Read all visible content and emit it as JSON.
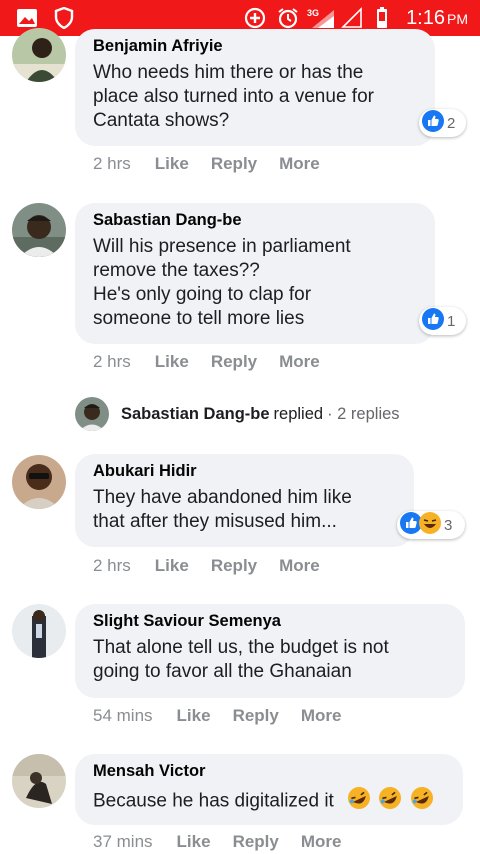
{
  "status_bar": {
    "time": "1:16",
    "ampm": "PM",
    "network": "3G",
    "icons": [
      "gallery-icon",
      "shield-icon",
      "add-circle-icon",
      "alarm-icon",
      "signal-3g-icon",
      "signal-empty-icon",
      "battery-icon"
    ]
  },
  "colors": {
    "status_bar": "#f01818",
    "bubble": "#f0f2f5",
    "like_blue": "#1877f2",
    "meta_gray": "#8a8d91"
  },
  "actions": {
    "like": "Like",
    "reply": "Reply",
    "more": "More"
  },
  "comments": [
    {
      "name": "Benjamin Afriyie",
      "text": "Who needs him there or has the\nplace also turned into a venue for\nCantata shows?",
      "time": "2 hrs",
      "reactions": [
        "like"
      ],
      "reaction_count": "2"
    },
    {
      "name": "Sabastian Dang-be",
      "text": "Will his presence in parliament\nremove the taxes??\nHe's only going to clap for\nsomeone to tell more lies",
      "time": "2 hrs",
      "reactions": [
        "like"
      ],
      "reaction_count": "1"
    },
    {
      "name": "Abukari Hidir",
      "text": "They have abandoned him like\nthat after they misused him...",
      "time": "2 hrs",
      "reactions": [
        "like",
        "haha"
      ],
      "reaction_count": "3"
    },
    {
      "name": "Slight Saviour Semenya",
      "text": "That alone tell us, the budget is not\ngoing to favor all the Ghanaian",
      "time": "54 mins",
      "reactions": [],
      "reaction_count": ""
    },
    {
      "name": "Mensah Victor",
      "text": "Because he has digitalized it",
      "emoji_count": 3,
      "time": "37 mins",
      "reactions": [],
      "reaction_count": ""
    }
  ],
  "replied_row": {
    "name": "Sabastian Dang-be",
    "text": "replied",
    "count": "· 2 replies"
  }
}
